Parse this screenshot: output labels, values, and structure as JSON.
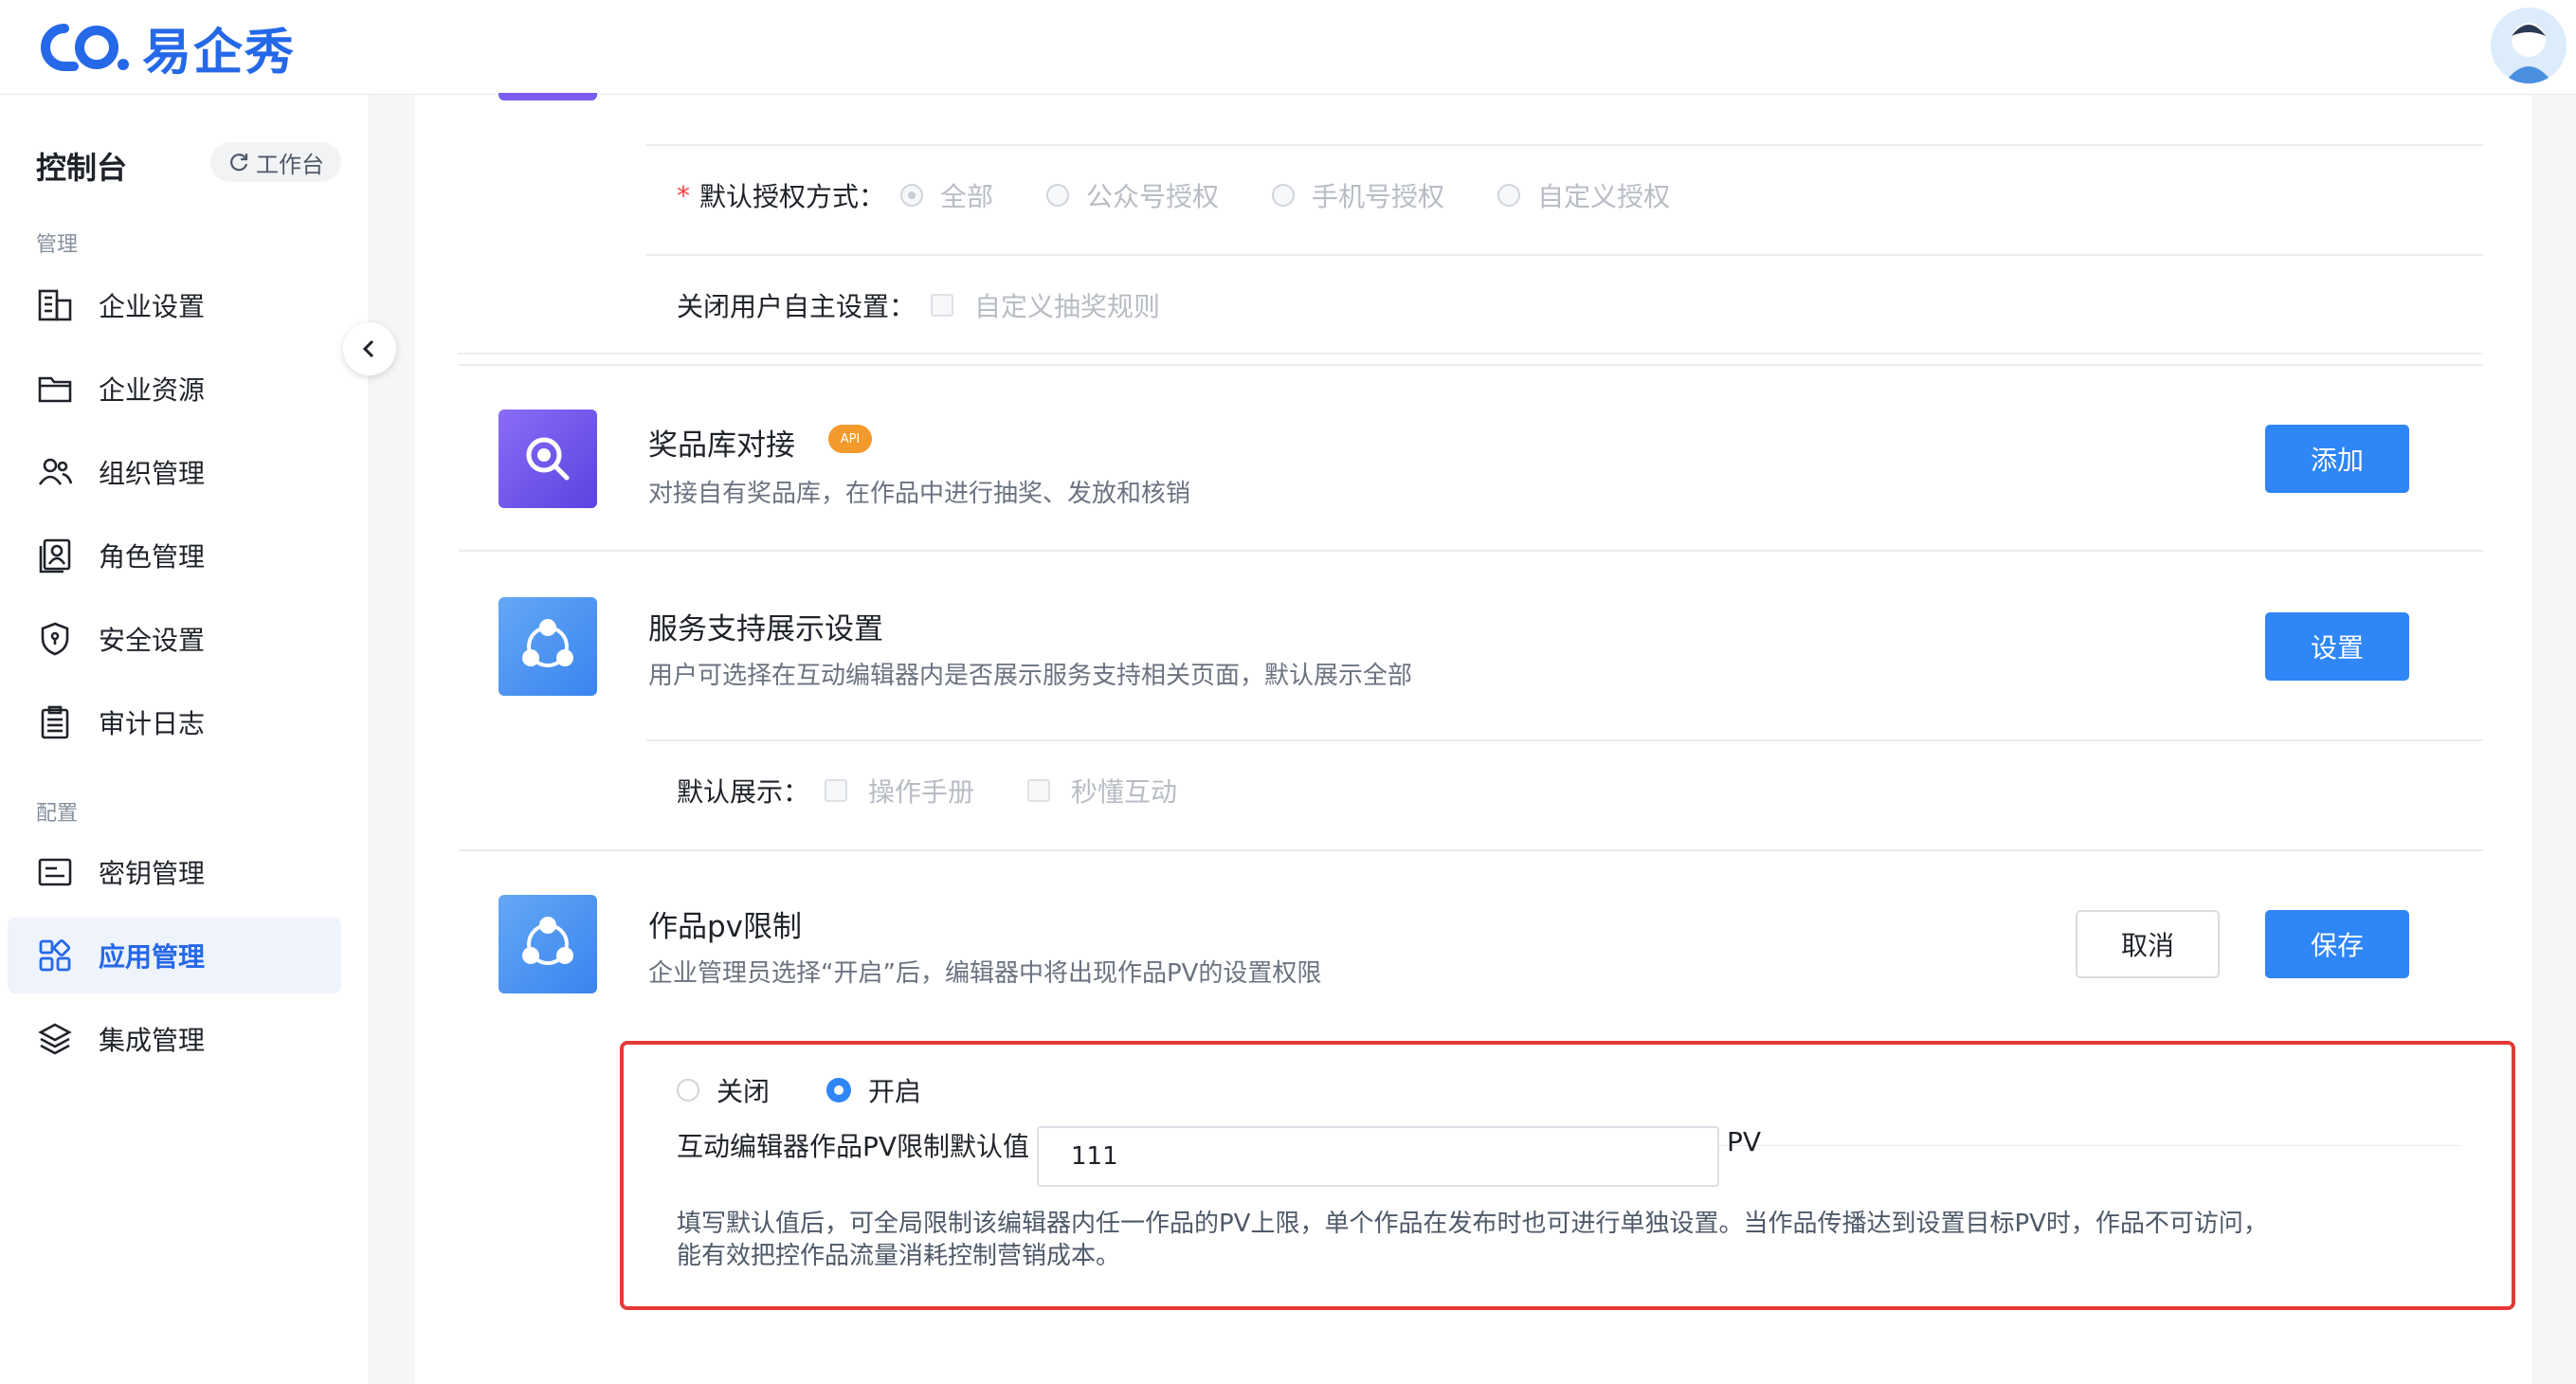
{
  "header": {
    "logo_text": "易企秀",
    "avatar_icon": "user-avatar-icon"
  },
  "sidebar": {
    "title": "控制台",
    "workbench_label": "工作台",
    "groups": [
      {
        "label": "管理"
      },
      {
        "label": "配置"
      }
    ],
    "items": [
      {
        "label": "企业设置",
        "icon": "building-icon"
      },
      {
        "label": "企业资源",
        "icon": "folder-icon"
      },
      {
        "label": "组织管理",
        "icon": "users-icon"
      },
      {
        "label": "角色管理",
        "icon": "id-card-icon"
      },
      {
        "label": "安全设置",
        "icon": "shield-icon"
      },
      {
        "label": "审计日志",
        "icon": "clipboard-icon"
      },
      {
        "label": "密钥管理",
        "icon": "key-card-icon"
      },
      {
        "label": "应用管理",
        "icon": "apps-icon",
        "active": true
      },
      {
        "label": "集成管理",
        "icon": "layers-icon"
      }
    ]
  },
  "auth_section": {
    "label": "默认授权方式：",
    "options": [
      "全部",
      "公众号授权",
      "手机号授权",
      "自定义授权"
    ],
    "selected": "全部",
    "close_label": "关闭用户自主设置：",
    "close_option": "自定义抽奖规则"
  },
  "prize": {
    "title": "奖品库对接",
    "badge": "API",
    "desc": "对接自有奖品库，在作品中进行抽奖、发放和核销",
    "button": "添加"
  },
  "service": {
    "title": "服务支持展示设置",
    "desc": "用户可选择在互动编辑器内是否展示服务支持相关页面，默认展示全部",
    "button": "设置",
    "default_label": "默认展示：",
    "options": [
      "操作手册",
      "秒懂互动"
    ]
  },
  "pv": {
    "title": "作品pv限制",
    "desc": "企业管理员选择“开启”后，编辑器中将出现作品PV的设置权限",
    "cancel": "取消",
    "save": "保存",
    "radio_off": "关闭",
    "radio_on": "开启",
    "selected": "开启",
    "input_label": "互动编辑器作品PV限制默认值",
    "input_value": "111",
    "unit": "PV",
    "note_line1": "填写默认值后，可全局限制该编辑器内任一作品的PV上限，单个作品在发布时也可进行单独设置。当作品传播达到设置目标PV时，作品不可访问，",
    "note_line2": "能有效把控作品流量消耗控制营销成本。"
  },
  "colors": {
    "primary": "#2f86f6",
    "brand": "#2568e8",
    "highlight_border": "#e53935",
    "api_badge": "#f39a2c"
  }
}
